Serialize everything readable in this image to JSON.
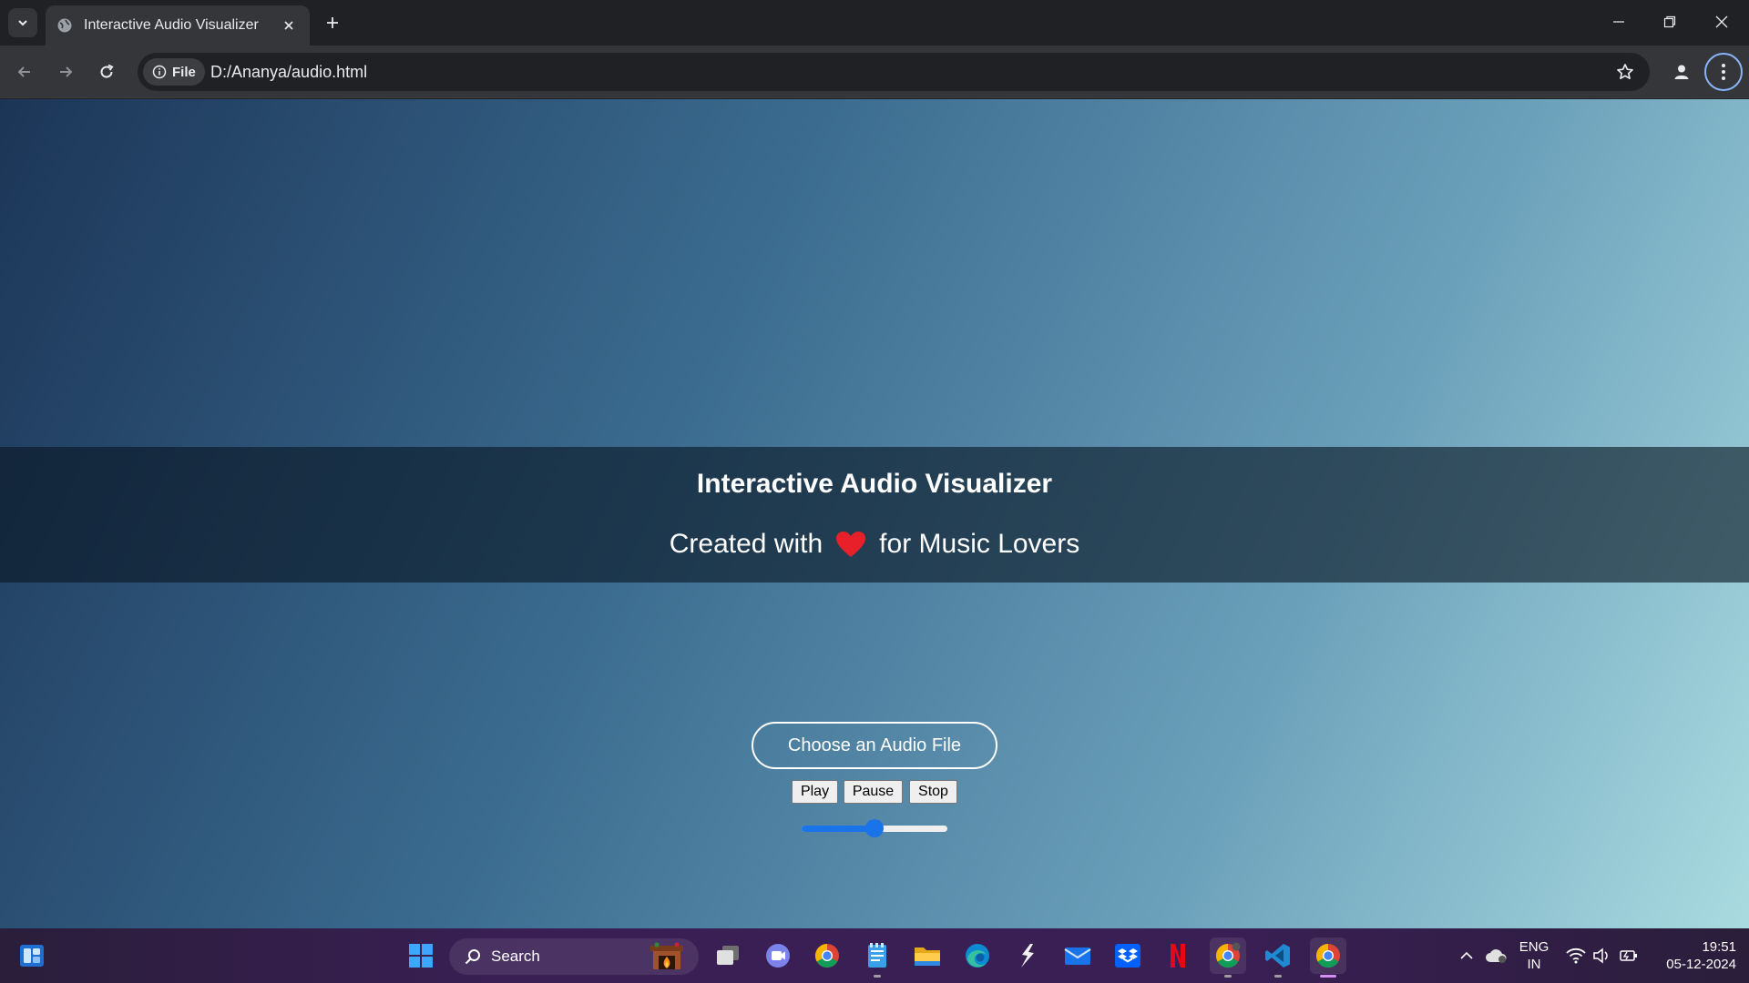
{
  "browser": {
    "tab_title": "Interactive Audio Visualizer",
    "chip_label": "File",
    "url": "D:/Ananya/audio.html"
  },
  "page": {
    "heading": "Interactive Audio Visualizer",
    "tagline_before": "Created with",
    "tagline_after": "for Music Lovers",
    "choose_file_label": "Choose an Audio File",
    "play_label": "Play",
    "pause_label": "Pause",
    "stop_label": "Stop",
    "volume_fraction": 0.5,
    "accent_color": "#1a73e8",
    "heart_color": "#e8202a"
  },
  "taskbar": {
    "search_label": "Search",
    "lang_line1": "ENG",
    "lang_line2": "IN",
    "time": "19:51",
    "date": "05-12-2024",
    "pinned_icons": [
      "widgets-icon",
      "start-icon",
      "task-view-icon",
      "meet-icon",
      "chrome-icon",
      "notepad-icon",
      "file-explorer-icon",
      "edge-icon",
      "bolt-app-icon",
      "mail-icon",
      "dropbox-icon",
      "netflix-icon",
      "chrome-profile-icon",
      "vscode-icon",
      "chrome-active-icon"
    ]
  }
}
